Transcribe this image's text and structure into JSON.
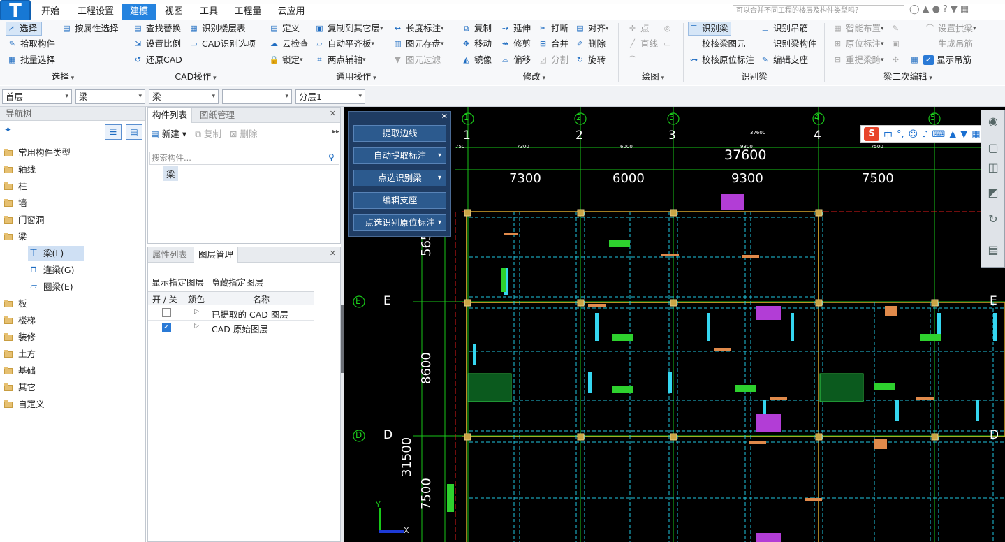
{
  "app": {
    "icon_letter": "T"
  },
  "tabs": [
    {
      "label": "开始"
    },
    {
      "label": "工程设置"
    },
    {
      "label": "建模"
    },
    {
      "label": "视图"
    },
    {
      "label": "工具"
    },
    {
      "label": "工程量"
    },
    {
      "label": "云应用"
    }
  ],
  "help_search": {
    "placeholder": "可以合并不同工程的楼层及构件类型吗？"
  },
  "ribbon": {
    "select": {
      "items": [
        "选择",
        "按属性选择",
        "拾取构件",
        "批量选择"
      ],
      "group": "选择"
    },
    "cad": {
      "items": [
        "查找替换",
        "识别楼层表",
        "设置比例",
        "CAD识别选项",
        "还原CAD"
      ],
      "group": "CAD操作"
    },
    "common": {
      "items": [
        "定义",
        "复制到其它层",
        "长度标注",
        "云检查",
        "自动平齐板",
        "图元存盘",
        "锁定",
        "两点辅轴",
        "图元过滤"
      ],
      "group": "通用操作"
    },
    "modify": {
      "items": [
        "复制",
        "延伸",
        "打断",
        "对齐",
        "移动",
        "修剪",
        "合并",
        "删除",
        "镜像",
        "偏移",
        "分割",
        "旋转"
      ],
      "group": "修改"
    },
    "draw": {
      "items": [
        "点",
        "直线"
      ],
      "group": "绘图"
    },
    "recognize": {
      "items": [
        "识别梁",
        "识别吊筋",
        "校核梁图元",
        "识别梁构件",
        "校核原位标注",
        "编辑支座"
      ],
      "group": "识别梁"
    },
    "secondary": {
      "items": [
        "智能布置",
        "设置拱梁",
        "原位标注",
        "生成吊筋",
        "重提梁跨",
        "显示吊筋"
      ],
      "group": "梁二次编辑"
    }
  },
  "selectors": [
    "首层",
    "梁",
    "梁",
    "",
    "分层1"
  ],
  "nav": {
    "title": "导航树",
    "items": [
      "常用构件类型",
      "轴线",
      "柱",
      "墙",
      "门窗洞",
      "梁",
      "板",
      "楼梯",
      "装修",
      "土方",
      "基础",
      "其它",
      "自定义"
    ],
    "beam_children": [
      "梁(L)",
      "连梁(G)",
      "圈梁(E)"
    ]
  },
  "component_panel": {
    "tabs": [
      "构件列表",
      "图纸管理"
    ],
    "toolbar": [
      "新建",
      "复制",
      "删除"
    ],
    "search_placeholder": "搜索构件...",
    "items": [
      "梁"
    ]
  },
  "layer_panel": {
    "tabs": [
      "属性列表",
      "图层管理"
    ],
    "actions": [
      "显示指定图层",
      "隐藏指定图层"
    ],
    "columns": [
      "开 / 关",
      "颜色",
      "名称"
    ],
    "rows": [
      {
        "checked": false,
        "name": "已提取的 CAD 图层"
      },
      {
        "checked": true,
        "name": "CAD 原始图层"
      }
    ]
  },
  "float_panel": {
    "buttons": [
      "提取边线",
      "自动提取标注",
      "点选识别梁",
      "编辑支座",
      "点选识别原位标注"
    ]
  },
  "cad": {
    "axes_top": [
      "1",
      "2",
      "3",
      "4",
      "5"
    ],
    "axes_left": [
      "E",
      "D"
    ],
    "total_dim": "37600",
    "small_total": "37600",
    "spans": [
      "7300",
      "6000",
      "9300",
      "7500"
    ],
    "small_spans": [
      "7300",
      "6000",
      "9300",
      "7500"
    ],
    "vertical_dims": [
      "5650",
      "8600",
      "31500",
      "7500"
    ],
    "small_left": "750",
    "ucs": {
      "x": "X",
      "y": "Y"
    }
  },
  "ime": {
    "brand": "S",
    "lang": "中"
  }
}
